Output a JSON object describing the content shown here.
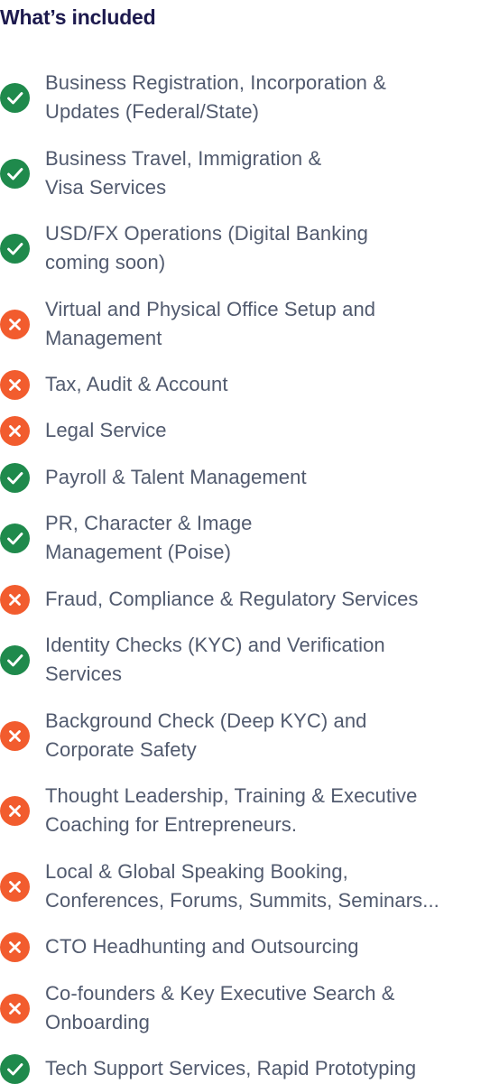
{
  "header": {
    "title": "What’s included"
  },
  "colors": {
    "title": "#1d1a4e",
    "text": "#515a6e",
    "included": "#1f8a4c",
    "excluded": "#f25c2e"
  },
  "features": [
    {
      "label": "Business Registration, Incorporation &\nUpdates (Federal/State)",
      "included": true,
      "icon": "check-circle-icon"
    },
    {
      "label": "Business Travel, Immigration &\nVisa Services",
      "included": true,
      "icon": "check-circle-icon"
    },
    {
      "label": "USD/FX Operations (Digital Banking\ncoming soon)",
      "included": true,
      "icon": "check-circle-icon"
    },
    {
      "label": "Virtual and Physical Office  Setup and\nManagement",
      "included": false,
      "icon": "x-circle-icon"
    },
    {
      "label": "Tax, Audit & Account",
      "included": false,
      "icon": "x-circle-icon"
    },
    {
      "label": "Legal Service",
      "included": false,
      "icon": "x-circle-icon"
    },
    {
      "label": "Payroll & Talent Management",
      "included": true,
      "icon": "check-circle-icon"
    },
    {
      "label": "PR, Character & Image\nManagement (Poise)",
      "included": true,
      "icon": "check-circle-icon"
    },
    {
      "label": "Fraud, Compliance & Regulatory Services",
      "included": false,
      "icon": "x-circle-icon"
    },
    {
      "label": "Identity Checks (KYC) and Verification\nServices",
      "included": true,
      "icon": "check-circle-icon"
    },
    {
      "label": "Background Check (Deep KYC) and\nCorporate Safety",
      "included": false,
      "icon": "x-circle-icon"
    },
    {
      "label": "Thought Leadership, Training & Executive\nCoaching for Entrepreneurs.",
      "included": false,
      "icon": "x-circle-icon"
    },
    {
      "label": "Local & Global Speaking Booking,\nConferences, Forums, Summits, Seminars...",
      "included": false,
      "icon": "x-circle-icon"
    },
    {
      "label": "CTO Headhunting and Outsourcing",
      "included": false,
      "icon": "x-circle-icon"
    },
    {
      "label": "Co-founders & Key Executive Search &\nOnboarding",
      "included": false,
      "icon": "x-circle-icon"
    },
    {
      "label": "Tech Support Services, Rapid Prototyping",
      "included": true,
      "icon": "check-circle-icon"
    }
  ]
}
